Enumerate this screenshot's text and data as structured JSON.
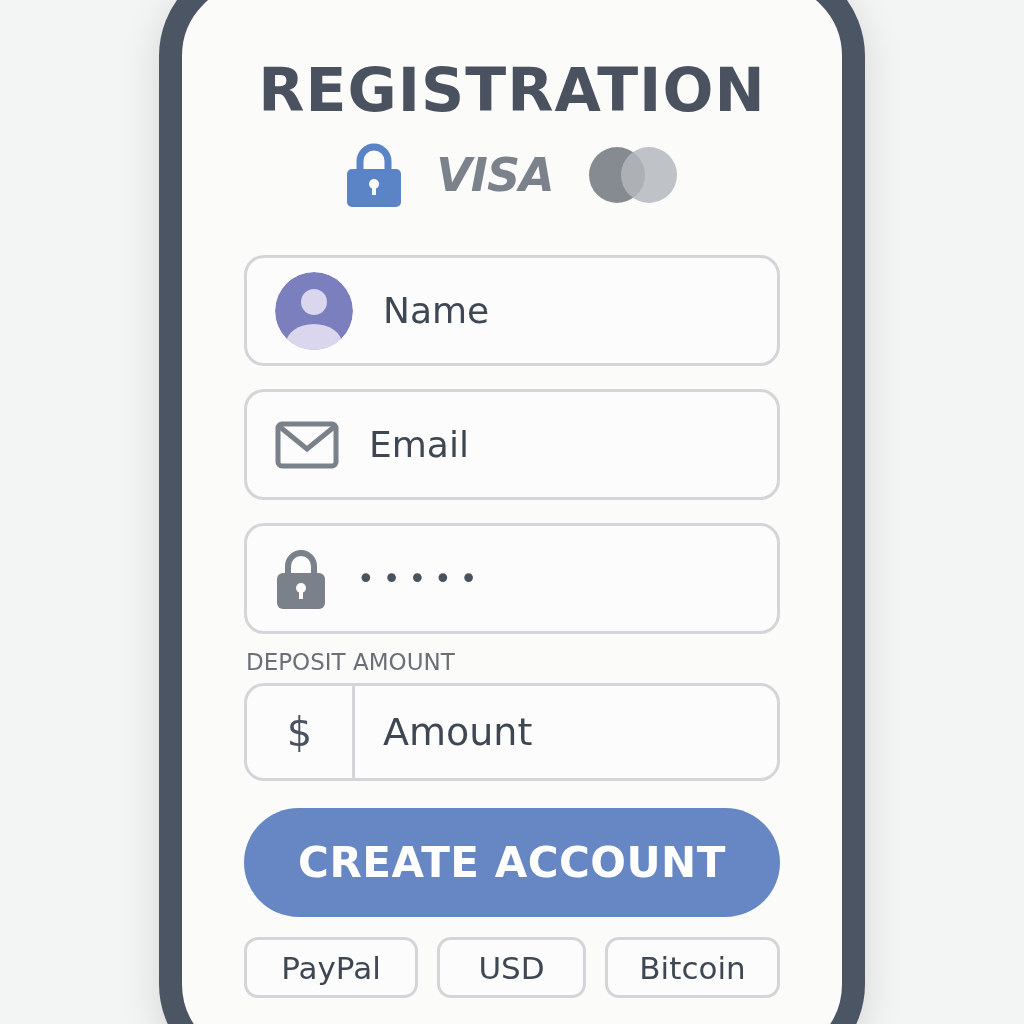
{
  "title": "REGISTRATION",
  "badges": {
    "card_brand": "VISA"
  },
  "fields": [
    {
      "kind": "avatar",
      "placeholder": "Name"
    },
    {
      "kind": "email",
      "placeholder": "Email"
    },
    {
      "kind": "password",
      "value": "•••••"
    }
  ],
  "deposit": {
    "label": "DEPOSIT AMOUNT",
    "prefix": "$",
    "placeholder": "Amount"
  },
  "submit": "CREATE ACCOUNT",
  "options": [
    "PayPal",
    "USD",
    "Bitcoin"
  ]
}
